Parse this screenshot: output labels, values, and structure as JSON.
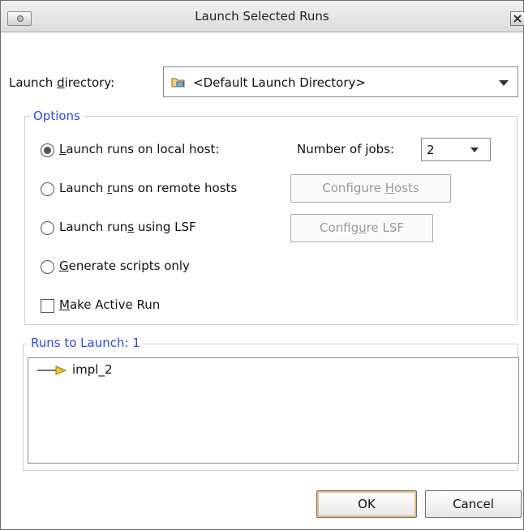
{
  "window": {
    "title": "Launch Selected Runs"
  },
  "launch_directory": {
    "label_pre": "Launch ",
    "label_mnemonic": "d",
    "label_post": "irectory:",
    "value": "<Default Launch Directory>",
    "icon": "folder-icon"
  },
  "options": {
    "title": "Options",
    "local": {
      "pre": "",
      "mn": "L",
      "post": "aunch runs on local host:",
      "selected": true
    },
    "jobs": {
      "pre": "Number of ",
      "mn": "j",
      "post": "obs:",
      "value": "2"
    },
    "remote": {
      "pre": "Launch ",
      "mn": "r",
      "post": "uns on remote hosts",
      "selected": false
    },
    "configure_hosts": {
      "pre": "Configure ",
      "mn": "H",
      "post": "osts",
      "enabled": false
    },
    "lsf": {
      "pre": "Launch run",
      "mn": "s",
      "post": " using LSF",
      "selected": false
    },
    "configure_lsf": {
      "pre": "Config",
      "mn": "u",
      "post": "re LSF",
      "enabled": false
    },
    "scripts": {
      "pre": "",
      "mn": "G",
      "post": "enerate scripts only",
      "selected": false
    },
    "make_active": {
      "pre": "",
      "mn": "M",
      "post": "ake Active Run",
      "checked": false
    }
  },
  "runs": {
    "title": "Runs to Launch: 1",
    "items": [
      {
        "name": "impl_2",
        "icon": "arrow-right-icon"
      }
    ]
  },
  "buttons": {
    "ok": "OK",
    "cancel": "Cancel"
  }
}
